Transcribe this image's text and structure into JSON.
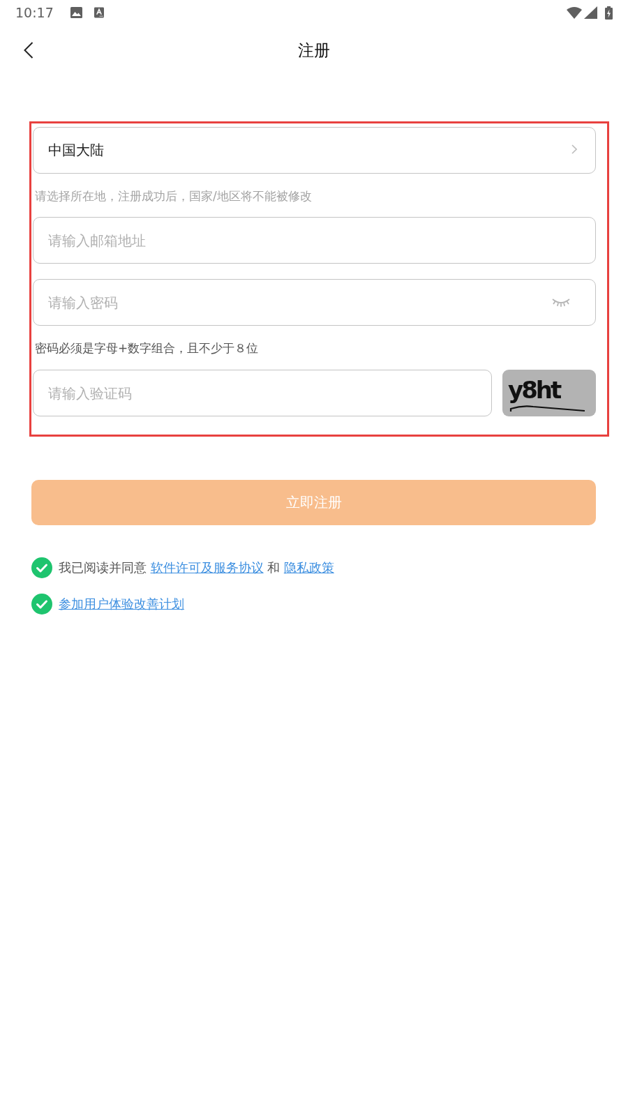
{
  "status_bar": {
    "time": "10:17"
  },
  "header": {
    "title": "注册"
  },
  "form": {
    "region": {
      "value": "中国大陆"
    },
    "region_hint": "请选择所在地，注册成功后，国家/地区将不能被修改",
    "email": {
      "placeholder": "请输入邮箱地址"
    },
    "password": {
      "placeholder": "请输入密码",
      "revealed": false
    },
    "password_hint": "密码必须是字母+数字组合，且不少于８位",
    "captcha": {
      "placeholder": "请输入验证码",
      "code": "y8ht"
    }
  },
  "submit": {
    "label": "立即注册",
    "disabled": true
  },
  "agreements": [
    {
      "checked": true,
      "parts": [
        {
          "kind": "text",
          "text": "我已阅读并同意"
        },
        {
          "kind": "link",
          "text": "软件许可及服务协议"
        },
        {
          "kind": "text",
          "text": "和"
        },
        {
          "kind": "link",
          "text": "隐私政策"
        }
      ]
    },
    {
      "checked": true,
      "parts": [
        {
          "kind": "link",
          "text": "参加用户体验改善计划"
        }
      ]
    }
  ]
}
